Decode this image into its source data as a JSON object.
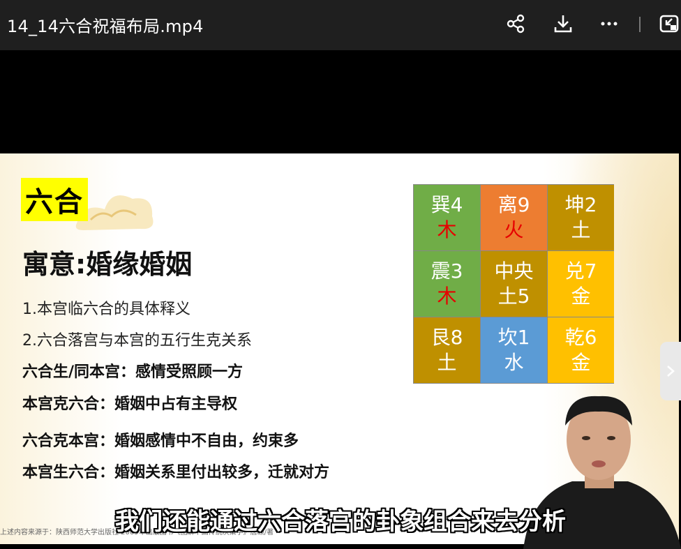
{
  "window": {
    "title": "14_14六合祝福布局.mp4"
  },
  "toolbar": {
    "icons": [
      "share-icon",
      "download-icon",
      "more-icon",
      "exit-fullscreen-icon"
    ]
  },
  "slide": {
    "tag": "六合",
    "meaning": "寓意:婚缘婚姻",
    "lines": [
      "1.本宫临六合的具体释义",
      "2.六合落宫与本宫的五行生克关系",
      "六合生/同本宫：感情受照顾一方",
      "本宫克六合：婚姻中占有主导权",
      "六合克本宫：婚姻感情中不自由，约束多",
      "本宫生六合：婚姻关系里付出较多，迁就对方"
    ],
    "source": "上述内容来源于：陕西师范大学出版社 2009年出版图书《图解中国传统决策学》唐颐/著",
    "grid": [
      {
        "name": "巽4",
        "element": "木",
        "bg": "#70ad47",
        "element_color": "#e60000"
      },
      {
        "name": "离9",
        "element": "火",
        "bg": "#ed7d31",
        "element_color": "#e60000"
      },
      {
        "name": "坤2",
        "element": "土",
        "bg": "#bf9000",
        "element_color": "#ffffff"
      },
      {
        "name": "震3",
        "element": "木",
        "bg": "#70ad47",
        "element_color": "#e60000"
      },
      {
        "name": "中央",
        "element": "土5",
        "bg": "#bf9000",
        "element_color": "#ffffff"
      },
      {
        "name": "兑7",
        "element": "金",
        "bg": "#ffc000",
        "element_color": "#ffffff"
      },
      {
        "name": "艮8",
        "element": "土",
        "bg": "#bf9000",
        "element_color": "#ffffff"
      },
      {
        "name": "坎1",
        "element": "水",
        "bg": "#5b9bd5",
        "element_color": "#ffffff"
      },
      {
        "name": "乾6",
        "element": "金",
        "bg": "#ffc000",
        "element_color": "#ffffff"
      }
    ]
  },
  "subtitle": "我们还能通过六合落宫的卦象组合来去分析",
  "colors": {
    "topbar": "#1f1f1f",
    "tag_bg": "#ffff00"
  }
}
